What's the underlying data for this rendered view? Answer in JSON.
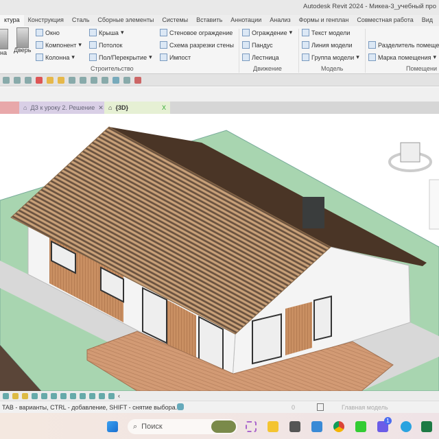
{
  "window": {
    "title": "Autodesk Revit 2024 - Микеа-3_учебный про"
  },
  "tabs": [
    "ктура",
    "Конструкция",
    "Сталь",
    "Сборные элементы",
    "Системы",
    "Вставить",
    "Аннотации",
    "Анализ",
    "Формы и генплан",
    "Совместная работа",
    "Вид"
  ],
  "ribbon": {
    "big": {
      "window": "на",
      "door": "Дверь"
    },
    "build": {
      "window": "Окно",
      "component": "Компонент",
      "column": "Колонна",
      "roof": "Крыша",
      "ceiling": "Потолок",
      "floor": "Пол/Перекрытие",
      "curtain_wall": "Стеновое ограждение",
      "curtain_grid": "Схема разрезки стены",
      "mullion": "Импост",
      "panel": "Строительство"
    },
    "circulation": {
      "railing": "Ограждение",
      "ramp": "Пандус",
      "stair": "Лестница",
      "panel": "Движение"
    },
    "model": {
      "text": "Текст модели",
      "line": "Линия модели",
      "group": "Группа модели",
      "panel": "Модель"
    },
    "room": {
      "separator": "Разделитель помеще",
      "tag": "Марка помещения",
      "panel": "Помещени"
    }
  },
  "doc_tabs": [
    {
      "label": "ДЗ к уроку 2. Решение",
      "close": "✕"
    },
    {
      "label": "{3D}",
      "close": "X"
    }
  ],
  "status": {
    "hint": "TAB - варианты, CTRL - добавление, SHIFT - снятие выбора.",
    "worksets": "0",
    "model": "Главная модель"
  },
  "taskbar": {
    "search": "Поиск",
    "badge": "1"
  },
  "colors": {
    "ground": "#a8d5b0",
    "roof": "#4a3526",
    "wood": "#c79068",
    "wall": "#f4f4f4"
  }
}
